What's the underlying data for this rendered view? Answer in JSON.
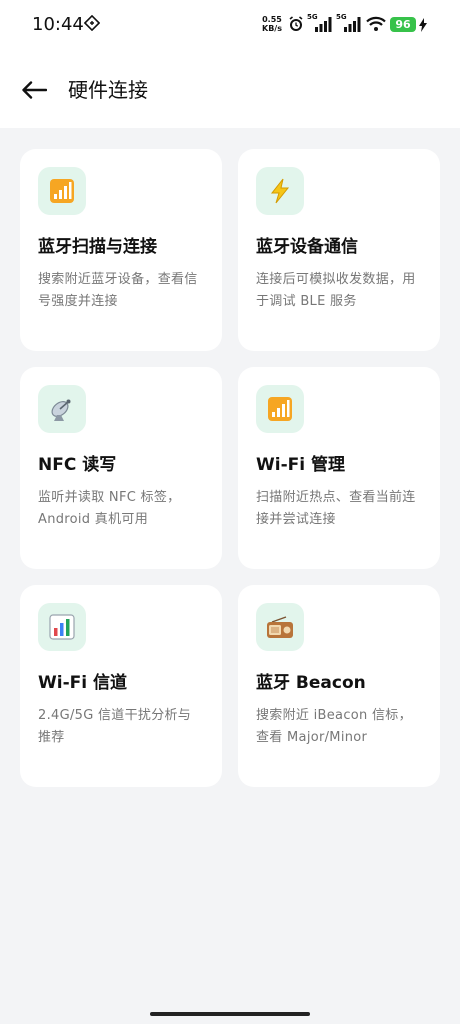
{
  "status_bar": {
    "time": "10:44",
    "net_speed_value": "0.55",
    "net_speed_unit": "KB/s",
    "sim1_label": "5G",
    "sim2_label": "5G",
    "battery": "96"
  },
  "header": {
    "title": "硬件连接"
  },
  "cards": [
    {
      "title": "蓝牙扫描与连接",
      "desc": "搜索附近蓝牙设备，查看信号强度并连接",
      "icon": "signal-bars-icon"
    },
    {
      "title": "蓝牙设备通信",
      "desc": "连接后可模拟收发数据，用于调试 BLE 服务",
      "icon": "lightning-icon"
    },
    {
      "title": "NFC 读写",
      "desc": "监听并读取 NFC 标签，Android 真机可用",
      "icon": "satellite-dish-icon"
    },
    {
      "title": "Wi-Fi 管理",
      "desc": "扫描附近热点、查看当前连接并尝试连接",
      "icon": "signal-bars-icon"
    },
    {
      "title": "Wi-Fi 信道",
      "desc": "2.4G/5G 信道干扰分析与推荐",
      "icon": "bar-chart-icon"
    },
    {
      "title": "蓝牙 Beacon",
      "desc": "搜索附近 iBeacon 信标，查看 Major/Minor",
      "icon": "radio-icon"
    }
  ],
  "colors": {
    "accent_bg": "#e2f5ec",
    "battery": "#37c24a",
    "page_bg": "#f3f4f6"
  }
}
